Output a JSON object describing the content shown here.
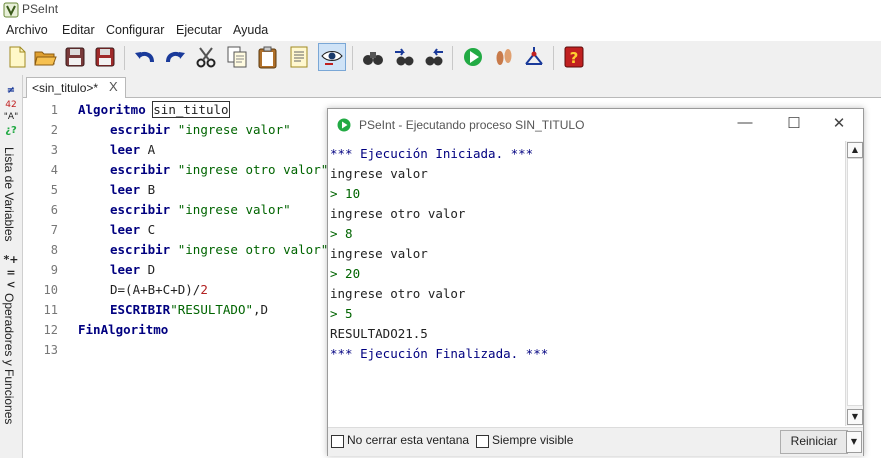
{
  "window": {
    "title": "PSeInt"
  },
  "menu": [
    "Archivo",
    "Editar",
    "Configurar",
    "Ejecutar",
    "Ayuda"
  ],
  "toolbar": {
    "buttons": [
      "new-file",
      "open",
      "save",
      "save-as",
      "undo",
      "redo",
      "cut",
      "copy",
      "paste",
      "format-code",
      "find",
      "run-step",
      "run",
      "debug",
      "flowchart",
      "profile",
      "help"
    ]
  },
  "tab": {
    "label": "<sin_titulo>*",
    "close": "X"
  },
  "sidebar": {
    "vars_label": "Lista de Variables",
    "ops_label": "Operadores y Funciones"
  },
  "editor": {
    "line_numbers": [
      "1",
      "2",
      "3",
      "4",
      "5",
      "6",
      "7",
      "8",
      "9",
      "10",
      "11",
      "12",
      "13"
    ],
    "lines": [
      {
        "kw": "Algoritmo",
        "rest": "sin_titulo"
      },
      {
        "kw": "escribir",
        "str": "\"ingrese valor\""
      },
      {
        "kw": "leer",
        "id": "A"
      },
      {
        "kw": "escribir",
        "str": "\"ingrese otro valor\""
      },
      {
        "kw": "leer",
        "id": "B"
      },
      {
        "kw": "escribir",
        "str": "\"ingrese valor\""
      },
      {
        "kw": "leer",
        "id": "C"
      },
      {
        "kw": "escribir",
        "str": "\"ingrese otro valor\""
      },
      {
        "kw": "leer",
        "id": "D"
      },
      {
        "code": "D=(A+B+C+D)/",
        "num": "2"
      },
      {
        "kw": "ESCRIBIR",
        "str": "\"RESULTADO\"",
        "tail": ",D"
      },
      {
        "kw": "FinAlgoritmo"
      },
      {}
    ]
  },
  "run_dialog": {
    "title": "PSeInt - Ejecutando proceso SIN_TITULO",
    "minimize": "—",
    "maximize": "☐",
    "close": "✕",
    "console": [
      "*** Ejecución Iniciada. ***",
      "ingrese valor",
      "> 10",
      "ingrese otro valor",
      "> 8",
      "ingrese valor",
      "> 20",
      "ingrese otro valor",
      "> 5",
      "RESULTADO21.5",
      "*** Ejecución Finalizada. ***"
    ],
    "no_cerrar_label": "No cerrar esta ventana",
    "siempre_visible_label": "Siempre visible",
    "reiniciar_label": "Reiniciar"
  },
  "colors": {
    "keyword": "#000080",
    "string": "#006400",
    "number": "#b22222"
  }
}
